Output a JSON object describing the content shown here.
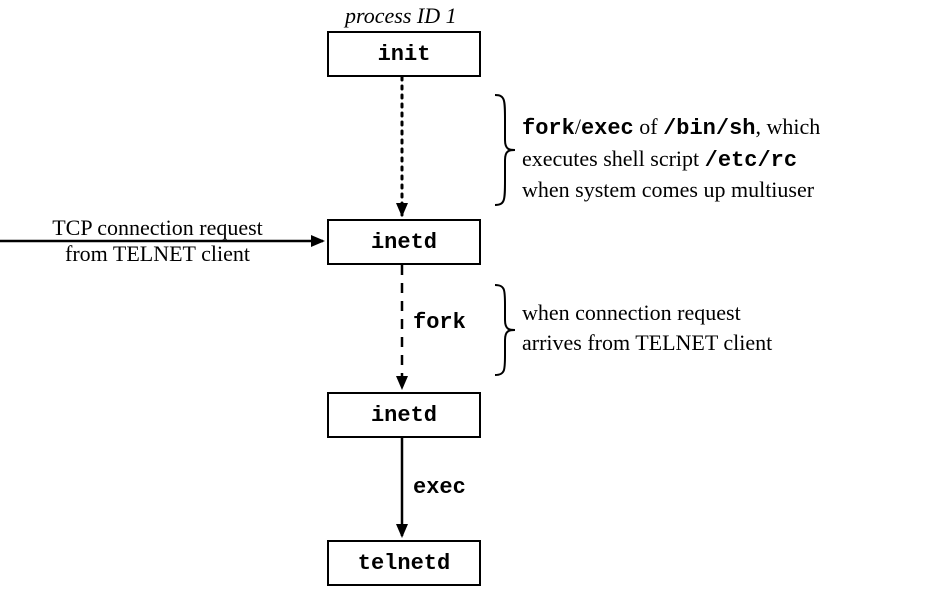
{
  "top_label": "process ID 1",
  "boxes": {
    "init": "init",
    "inetd1": "inetd",
    "inetd2": "inetd",
    "telnetd": "telnetd"
  },
  "left_label_line1": "TCP connection request",
  "left_label_line2": "from TELNET client",
  "right1_line1_a": "fork",
  "right1_line1_b": "/",
  "right1_line1_c": "exec",
  "right1_line1_d": " of ",
  "right1_line1_e": "/bin/sh",
  "right1_line1_f": ", which",
  "right1_line2_a": "executes shell script ",
  "right1_line2_b": "/etc/rc",
  "right1_line3": "when system comes up multiuser",
  "right2_line1": "when connection request",
  "right2_line2": "arrives from TELNET client",
  "edge_fork": "fork",
  "edge_exec": "exec",
  "chart_data": {
    "type": "flow_diagram",
    "nodes": [
      {
        "id": "init",
        "label": "init",
        "note": "process ID 1"
      },
      {
        "id": "inetd1",
        "label": "inetd"
      },
      {
        "id": "inetd2",
        "label": "inetd"
      },
      {
        "id": "telnetd",
        "label": "telnetd"
      }
    ],
    "edges": [
      {
        "from": "init",
        "to": "inetd1",
        "style": "dotted",
        "annotation": "fork/exec of /bin/sh, which executes shell script /etc/rc when system comes up multiuser"
      },
      {
        "from": "tcp-client",
        "to": "inetd1",
        "style": "solid",
        "annotation": "TCP connection request from TELNET client"
      },
      {
        "from": "inetd1",
        "to": "inetd2",
        "style": "dashed",
        "label": "fork",
        "annotation": "when connection request arrives from TELNET client"
      },
      {
        "from": "inetd2",
        "to": "telnetd",
        "style": "solid",
        "label": "exec"
      }
    ]
  }
}
